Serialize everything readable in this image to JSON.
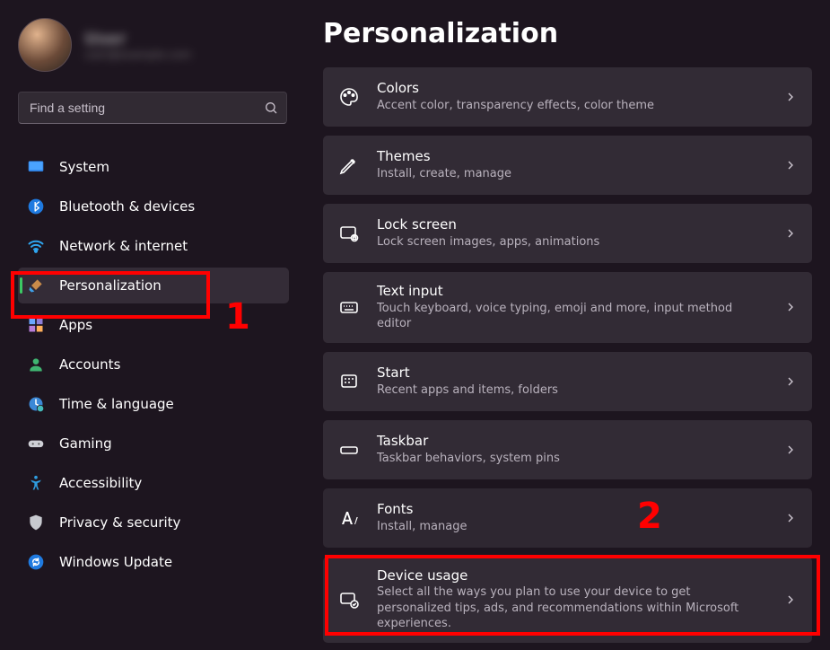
{
  "user": {
    "name": "User",
    "sub": "user@example.com"
  },
  "search": {
    "placeholder": "Find a setting"
  },
  "sidebar": {
    "items": [
      {
        "label": "System",
        "icon": "display-icon",
        "active": false
      },
      {
        "label": "Bluetooth & devices",
        "icon": "bluetooth-icon",
        "active": false
      },
      {
        "label": "Network & internet",
        "icon": "wifi-icon",
        "active": false
      },
      {
        "label": "Personalization",
        "icon": "paintbrush-icon",
        "active": true
      },
      {
        "label": "Apps",
        "icon": "apps-icon",
        "active": false
      },
      {
        "label": "Accounts",
        "icon": "person-icon",
        "active": false
      },
      {
        "label": "Time & language",
        "icon": "clock-globe-icon",
        "active": false
      },
      {
        "label": "Gaming",
        "icon": "gamepad-icon",
        "active": false
      },
      {
        "label": "Accessibility",
        "icon": "accessibility-icon",
        "active": false
      },
      {
        "label": "Privacy & security",
        "icon": "shield-icon",
        "active": false
      },
      {
        "label": "Windows Update",
        "icon": "update-icon",
        "active": false
      }
    ]
  },
  "page": {
    "title": "Personalization",
    "cards": [
      {
        "title": "Colors",
        "sub": "Accent color, transparency effects, color theme",
        "icon": "palette-icon"
      },
      {
        "title": "Themes",
        "sub": "Install, create, manage",
        "icon": "pen-icon"
      },
      {
        "title": "Lock screen",
        "sub": "Lock screen images, apps, animations",
        "icon": "lockscreen-icon"
      },
      {
        "title": "Text input",
        "sub": "Touch keyboard, voice typing, emoji and more, input method editor",
        "icon": "keyboard-icon"
      },
      {
        "title": "Start",
        "sub": "Recent apps and items, folders",
        "icon": "start-icon"
      },
      {
        "title": "Taskbar",
        "sub": "Taskbar behaviors, system pins",
        "icon": "taskbar-icon"
      },
      {
        "title": "Fonts",
        "sub": "Install, manage",
        "icon": "fonts-icon",
        "dim": true
      },
      {
        "title": "Device usage",
        "sub": "Select all the ways you plan to use your device to get personalized tips, ads, and recommendations within Microsoft experiences.",
        "icon": "device-usage-icon"
      }
    ]
  },
  "annotations": {
    "one": "1",
    "two": "2"
  }
}
